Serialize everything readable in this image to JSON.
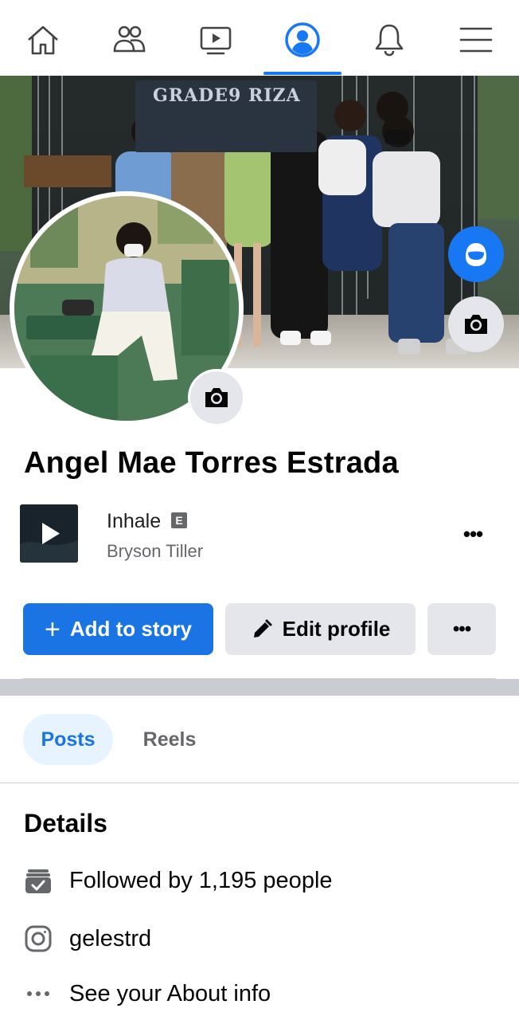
{
  "nav": {
    "items": [
      {
        "name": "home",
        "icon": "home-icon"
      },
      {
        "name": "friends",
        "icon": "friends-icon"
      },
      {
        "name": "video",
        "icon": "video-icon"
      },
      {
        "name": "profile",
        "icon": "profile-icon",
        "active": true
      },
      {
        "name": "notifications",
        "icon": "bell-icon"
      },
      {
        "name": "menu",
        "icon": "hamburger-icon"
      }
    ],
    "accent_color": "#1877f2"
  },
  "cover": {
    "banner_text": "GRADE9 RIZA",
    "photo_description_icon": "cover-photo"
  },
  "profile": {
    "name": "Angel Mae Torres Estrada"
  },
  "music": {
    "title": "Inhale",
    "explicit_badge": "E",
    "artist": "Bryson Tiller",
    "more_label": "•••"
  },
  "actions": {
    "add_story_label": "Add to story",
    "edit_profile_label": "Edit profile",
    "more_label": "•••"
  },
  "tabs": {
    "posts": "Posts",
    "reels": "Reels"
  },
  "details": {
    "title": "Details",
    "followed_by": "Followed by 1,195 people",
    "instagram": "gelestrd",
    "about": "See your About info"
  }
}
